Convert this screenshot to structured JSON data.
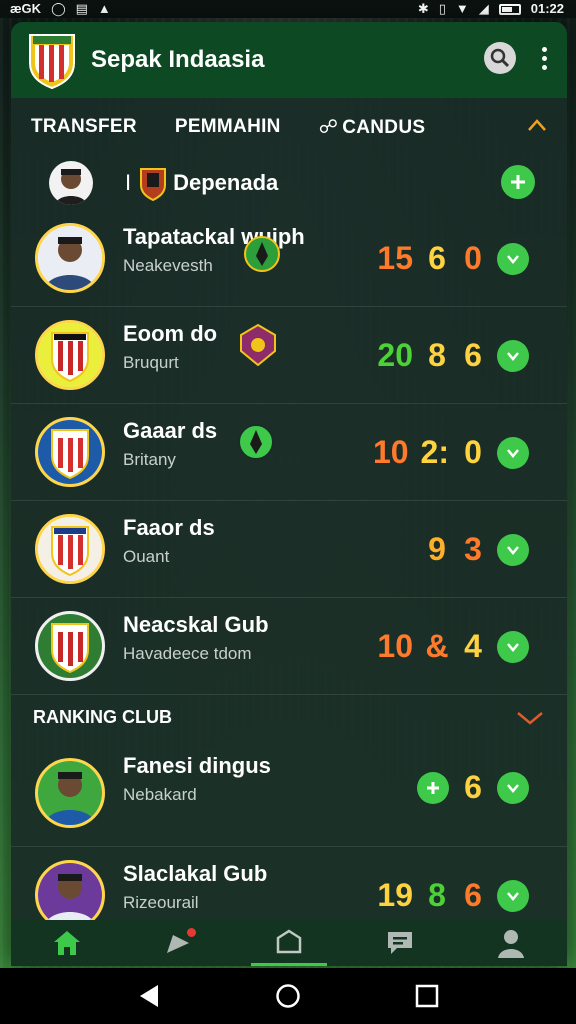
{
  "status_bar": {
    "left_label": "æGK",
    "time": "01:22"
  },
  "header": {
    "title": "Sepak Indaasia"
  },
  "tabs": [
    {
      "label": "TRANSFER"
    },
    {
      "label": "PEMMAHIN"
    },
    {
      "label": "CANDUS"
    }
  ],
  "favorite": {
    "prefix": "I",
    "name": "Depenada"
  },
  "clubs": [
    {
      "name": "Tapatackal wuiph",
      "sub": "Neakevesth",
      "scores": [
        "15",
        "6",
        "0"
      ],
      "score_colors": [
        "#ff7a2a",
        "#ffd23f",
        "#ff7a2a"
      ]
    },
    {
      "name": "Eoom do",
      "sub": "Bruqurt",
      "scores": [
        "20",
        "8",
        "6"
      ],
      "score_colors": [
        "#4cd137",
        "#ffd23f",
        "#ffd23f"
      ]
    },
    {
      "name": "Gaaar ds",
      "sub": "Britany",
      "scores": [
        "10",
        "2:",
        "0"
      ],
      "score_colors": [
        "#ff7a2a",
        "#ffd23f",
        "#ffd23f"
      ]
    },
    {
      "name": "Faaor ds",
      "sub": "Ouant",
      "scores": [
        "9",
        "3"
      ],
      "score_colors": [
        "#ffb02a",
        "#ff7a2a"
      ]
    },
    {
      "name": "Neacskal Gub",
      "sub": "Havadeece tdom",
      "scores": [
        "10",
        "&",
        "4"
      ],
      "score_colors": [
        "#ff7a2a",
        "#ff7a2a",
        "#ffd23f"
      ]
    }
  ],
  "ranking": {
    "title": "RANKING CLUB",
    "clubs": [
      {
        "name": "Fanesi dingus",
        "sub": "Nebakard",
        "scores": [
          "6"
        ],
        "score_colors": [
          "#ffd23f"
        ]
      },
      {
        "name": "Slaclakal Gub",
        "sub": "Rizeourail",
        "scores": [
          "19",
          "8",
          "6"
        ],
        "score_colors": [
          "#ffd23f",
          "#4cd137",
          "#ff7a2a"
        ]
      }
    ]
  },
  "colors": {
    "accent_green": "#3ec94a",
    "header_green": "#0d4a24",
    "panel_bg": "#1a2c26"
  },
  "icons": {
    "status": [
      "bluetooth-icon",
      "vibrate-icon",
      "wifi-icon",
      "signal-icon",
      "battery-icon"
    ],
    "bottom_nav": [
      "home-icon",
      "notification-icon",
      "shield-icon",
      "message-icon",
      "profile-icon"
    ],
    "android_nav": [
      "back-icon",
      "home-circle-icon",
      "recents-icon"
    ]
  }
}
